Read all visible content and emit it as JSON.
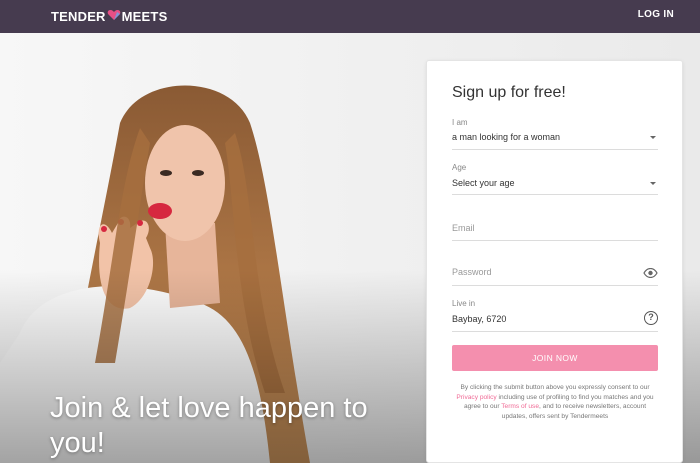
{
  "header": {
    "logo_left": "TENDER",
    "logo_right": "MEETS",
    "login_label": "LOG IN"
  },
  "hero": {
    "title": "Join & let love happen to you!"
  },
  "signup": {
    "title": "Sign up for free!",
    "iam": {
      "label": "I am",
      "value": "a man looking for a woman"
    },
    "age": {
      "label": "Age",
      "value": "Select your age"
    },
    "email": {
      "placeholder": "Email"
    },
    "password": {
      "placeholder": "Password"
    },
    "location": {
      "label": "Live in",
      "value": "Baybay, 6720",
      "help": "?"
    },
    "join_label": "JOIN NOW",
    "consent": {
      "part1": "By clicking the submit button above you expressly consent to our",
      "privacy_link": "Privacy policy",
      "part2": "including use of profiling to find you matches and you agree to our",
      "terms_link": "Terms of use",
      "part3": ", and to receive newsletters, account updates, offers sent by Tendermeets"
    }
  },
  "colors": {
    "header_bg": "#463b4f",
    "accent": "#f48fae",
    "link": "#f06b96"
  }
}
